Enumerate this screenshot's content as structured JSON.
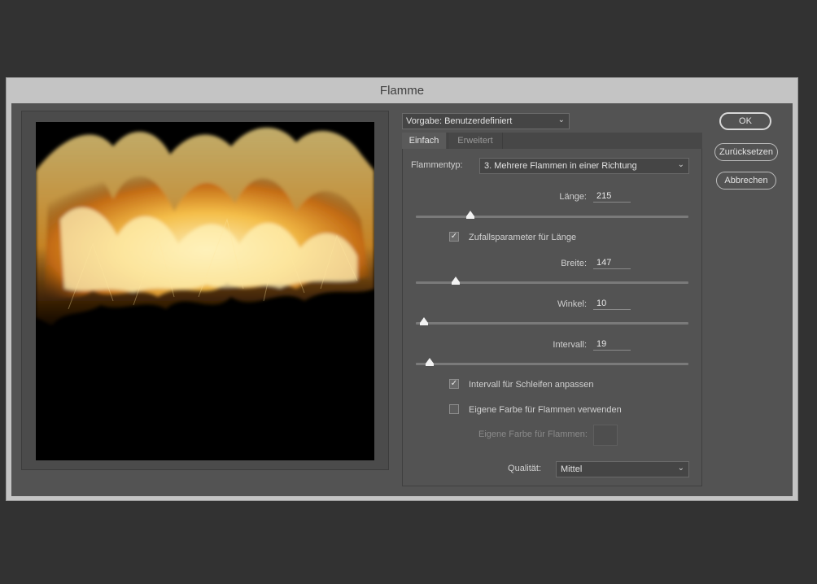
{
  "dialog": {
    "title": "Flamme"
  },
  "preset": {
    "label": "Vorgabe: Benutzerdefiniert"
  },
  "tabs": [
    {
      "label": "Einfach",
      "active": true
    },
    {
      "label": "Erweitert",
      "active": false
    }
  ],
  "flame_type": {
    "label": "Flammentyp:",
    "value": "3. Mehrere Flammen in einer Richtung"
  },
  "length": {
    "label": "Länge:",
    "value": "215",
    "slider_fraction": 0.2
  },
  "random_length": {
    "label": "Zufallsparameter für Länge",
    "checked": true
  },
  "width": {
    "label": "Breite:",
    "value": "147",
    "slider_fraction": 0.145
  },
  "angle": {
    "label": "Winkel:",
    "value": "10",
    "slider_fraction": 0.03
  },
  "interval": {
    "label": "Intervall:",
    "value": "19",
    "slider_fraction": 0.05
  },
  "loop_interval": {
    "label": "Intervall für Schleifen anpassen",
    "checked": true
  },
  "custom_color": {
    "label": "Eigene Farbe für Flammen verwenden",
    "checked": false
  },
  "custom_color_swatch": {
    "label": "Eigene Farbe für Flammen:"
  },
  "quality": {
    "label": "Qualität:",
    "value": "Mittel"
  },
  "buttons": {
    "ok": "OK",
    "reset": "Zurücksetzen",
    "cancel": "Abbrechen"
  },
  "colors": {
    "flame_core": "#fff3b0",
    "flame_mid": "#f5b43a",
    "flame_edge": "#b8620f"
  }
}
